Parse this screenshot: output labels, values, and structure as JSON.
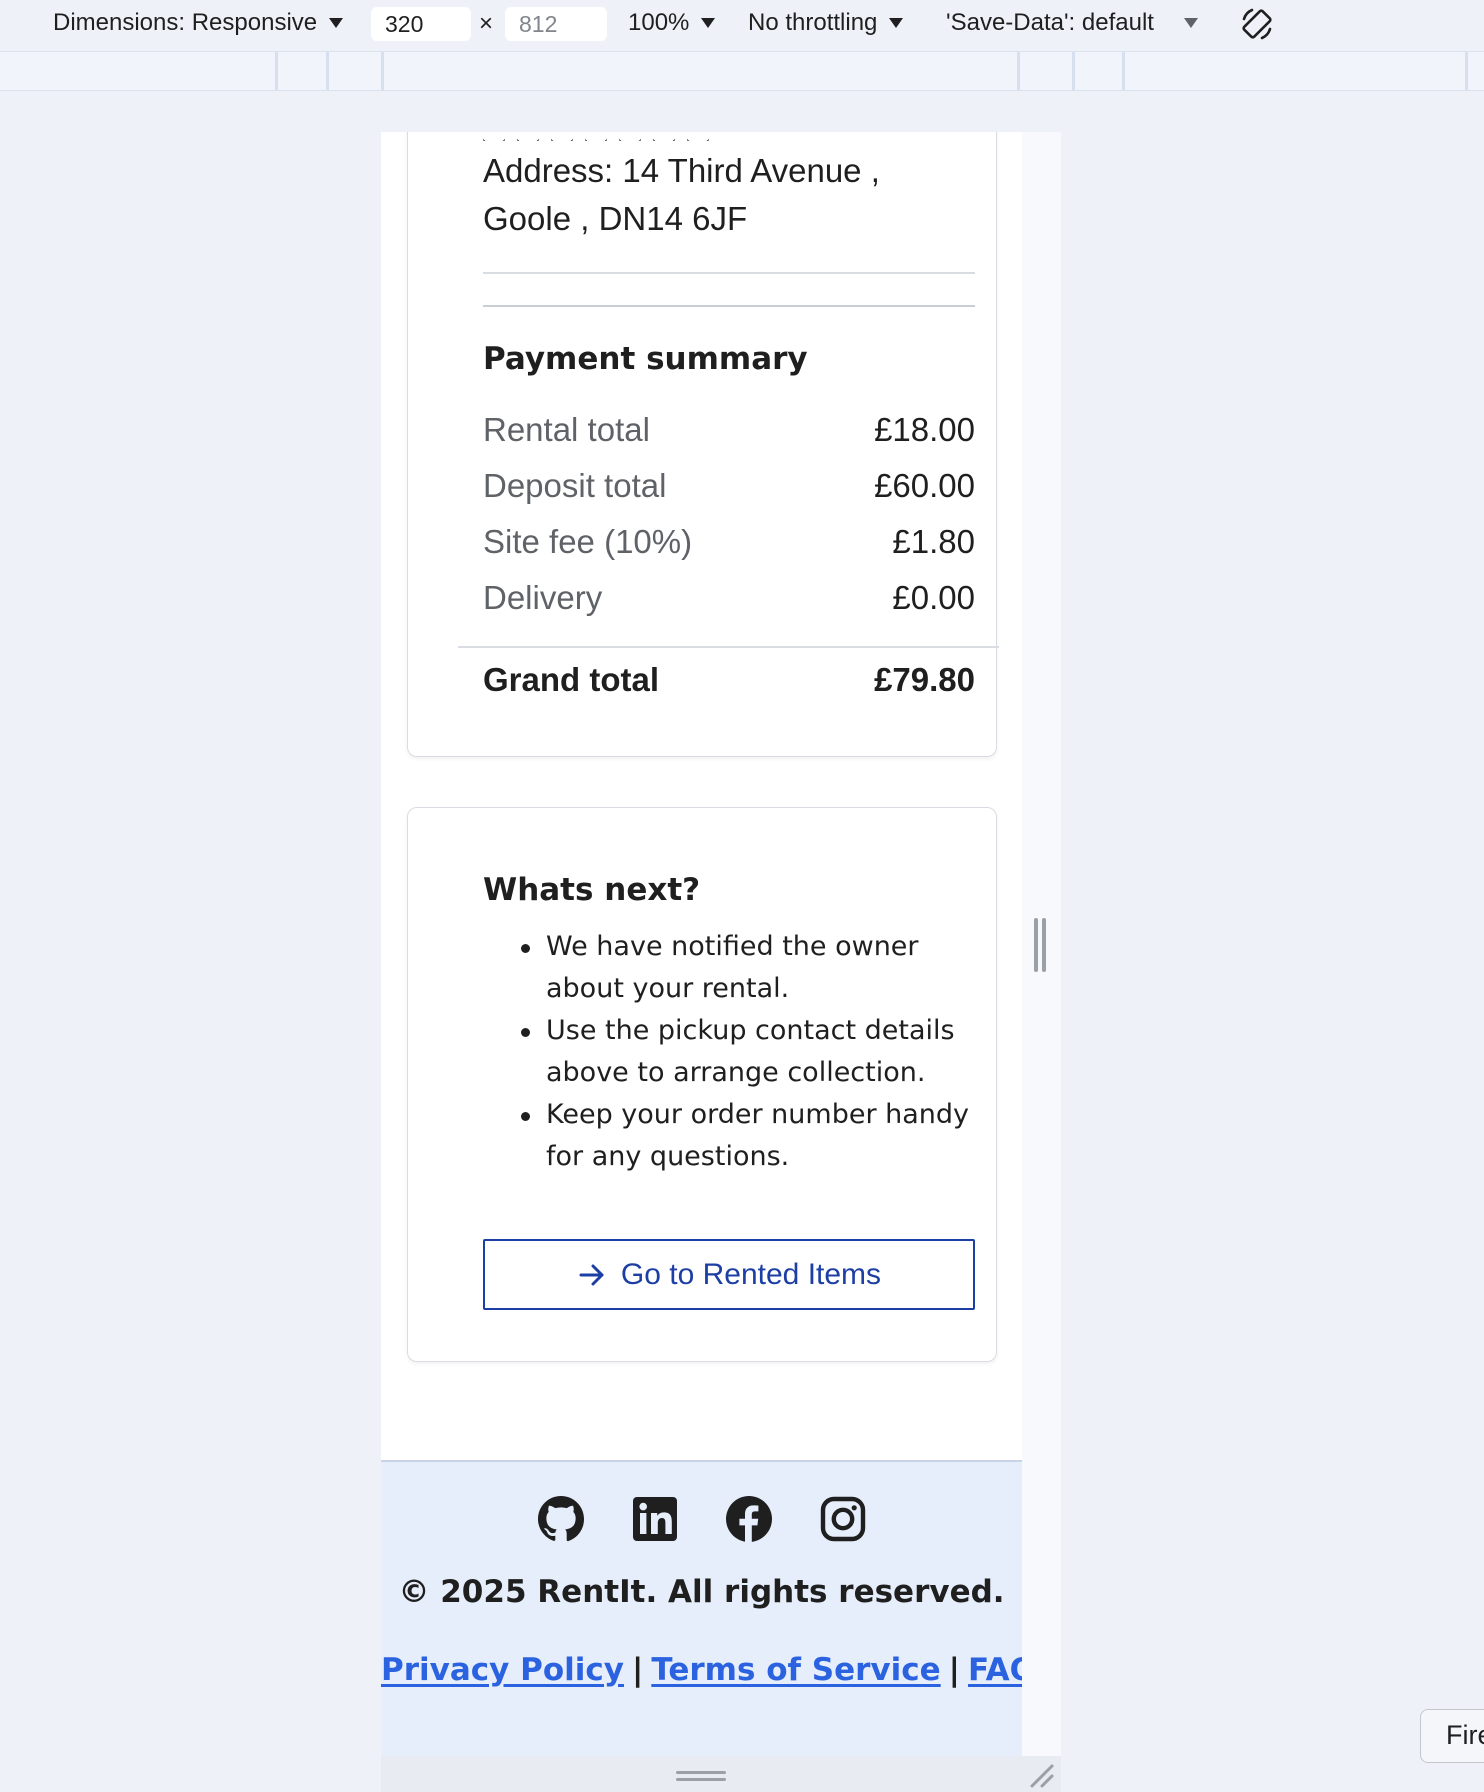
{
  "devtools": {
    "dimensions_label": "Dimensions: Responsive",
    "width_value": "320",
    "times_sign": "×",
    "height_placeholder": "812",
    "zoom": "100%",
    "throttling": "No throttling",
    "save_data": "'Save-Data': default"
  },
  "pickup": {
    "address_line1": "Address: 14 Third Avenue ,",
    "address_line2": "Goole , DN14 6JF"
  },
  "payment_summary": {
    "title": "Payment summary",
    "rows": [
      {
        "label": "Rental total",
        "value": "£18.00"
      },
      {
        "label": "Deposit total",
        "value": "£60.00"
      },
      {
        "label": "Site fee (10%)",
        "value": "£1.80"
      },
      {
        "label": "Delivery",
        "value": "£0.00"
      }
    ],
    "grand_total_label": "Grand total",
    "grand_total_value": "£79.80"
  },
  "whats_next": {
    "title": "Whats next?",
    "items": [
      "We have notified the owner about your rental.",
      "Use the pickup contact details above to arrange collection.",
      "Keep your order number handy for any questions."
    ],
    "button_label": "Go to Rented Items",
    "button_icon": "arrow-right-icon"
  },
  "footer": {
    "social_icons": [
      "github-icon",
      "linkedin-icon",
      "facebook-icon",
      "instagram-icon"
    ],
    "copyright": "© 2025 RentIt. All rights reserved.",
    "links": [
      "Privacy Policy",
      "Terms of Service",
      "FAQ"
    ],
    "link_separator": "|"
  },
  "side_tab": {
    "label": "Fire"
  },
  "colors": {
    "link": "#2b62e0",
    "button_accent": "#1d3fa5",
    "footer_bg": "#e6eefb",
    "devtools_bg": "#eef2f8"
  }
}
